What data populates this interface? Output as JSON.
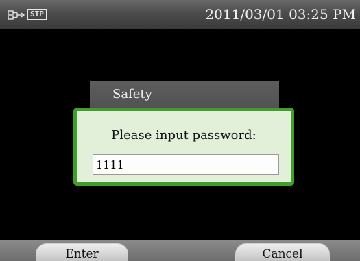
{
  "statusbar": {
    "icons": [
      "usb-icon",
      "stp-badge"
    ],
    "stp_label": "STP",
    "datetime": "2011/03/01 03:25 PM"
  },
  "dialog": {
    "title": "Safety",
    "prompt": "Please input password:",
    "password_value": "1111"
  },
  "softkeys": {
    "enter_label": "Enter",
    "cancel_label": "Cancel"
  },
  "colors": {
    "dialog_border": "#3f9f2a",
    "dialog_background": "#e2f0d9",
    "header_background": "#5d5d5d",
    "screen_background": "#000000"
  }
}
